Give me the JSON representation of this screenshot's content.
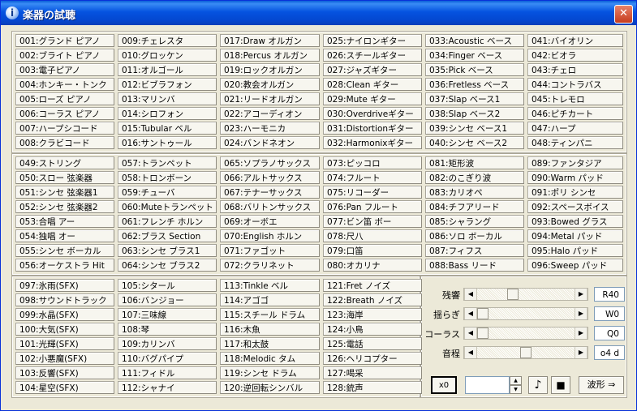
{
  "window": {
    "title": "楽器の試聴",
    "close_label": "✕"
  },
  "instruments": [
    "001:グランド ピアノ",
    "002:ブライト ピアノ",
    "003:電子ピアノ",
    "004:ホンキー・トンク",
    "005:ローズ ピアノ",
    "006:コーラス ピアノ",
    "007:ハープシコード",
    "008:クラビコード",
    "009:チェレスタ",
    "010:グロッケン",
    "011:オルゴール",
    "012:ビブラフォン",
    "013:マリンバ",
    "014:シロフォン",
    "015:Tubular ベル",
    "016:サントゥール",
    "017:Draw オルガン",
    "018:Percus オルガン",
    "019:ロックオルガン",
    "020:教会オルガン",
    "021:リードオルガン",
    "022:アコーディオン",
    "023:ハーモニカ",
    "024:バンドネオン",
    "025:ナイロンギター",
    "026:スチールギター",
    "027:ジャズギター",
    "028:Clean ギター",
    "029:Mute ギター",
    "030:Overdriveギター",
    "031:Distortionギター",
    "032:Harmonixギター",
    "033:Acoustic ベース",
    "034:Finger ベース",
    "035:Pick ベース",
    "036:Fretless ベース",
    "037:Slap ベース1",
    "038:Slap ベース2",
    "039:シンセ ベース1",
    "040:シンセ ベース2",
    "041:バイオリン",
    "042:ビオラ",
    "043:チェロ",
    "044:コントラバス",
    "045:トレモロ",
    "046:ピチカート",
    "047:ハープ",
    "048:ティンパニ",
    "049:ストリング",
    "050:スロー 弦楽器",
    "051:シンセ 弦楽器1",
    "052:シンセ 弦楽器2",
    "053:合唱 アー",
    "054:独唱 オー",
    "055:シンセ ボーカル",
    "056:オーケストラ Hit",
    "057:トランペット",
    "058:トロンボーン",
    "059:チューバ",
    "060:Muteトランペット",
    "061:フレンチ ホルン",
    "062:ブラス Section",
    "063:シンセ ブラス1",
    "064:シンセ ブラス2",
    "065:ソプラノサックス",
    "066:アルトサックス",
    "067:テナーサックス",
    "068:バリトンサックス",
    "069:オーボエ",
    "070:English ホルン",
    "071:ファゴット",
    "072:クラリネット",
    "073:ピッコロ",
    "074:フルート",
    "075:リコーダー",
    "076:Pan フルート",
    "077:ビン笛 ボー",
    "078:尺八",
    "079:口笛",
    "080:オカリナ",
    "081:矩形波",
    "082:のこぎり波",
    "083:カリオペ",
    "084:チフアリード",
    "085:シャラング",
    "086:ソロ ボーカル",
    "087:フィフス",
    "088:Bass リード",
    "089:ファンタジア",
    "090:Warm パッド",
    "091:ポリ シンセ",
    "092:スペースボイス",
    "093:Bowed グラス",
    "094:Metal パッド",
    "095:Halo パッド",
    "096:Sweep パッド",
    "097:氷雨(SFX)",
    "098:サウンドトラック",
    "099:水晶(SFX)",
    "100:大気(SFX)",
    "101:光輝(SFX)",
    "102:小悪魔(SFX)",
    "103:反響(SFX)",
    "104:星空(SFX)",
    "105:シタール",
    "106:バンジョー",
    "107:三味線",
    "108:琴",
    "109:カリンバ",
    "110:バグパイプ",
    "111:フィドル",
    "112:シャナイ",
    "113:Tinkle ベル",
    "114:アゴゴ",
    "115:スチール ドラム",
    "116:木魚",
    "117:和太鼓",
    "118:Melodic タム",
    "119:シンセ ドラム",
    "120:逆回転シンバル",
    "121:Fret ノイズ",
    "122:Breath ノイズ",
    "123:海岸",
    "124:小鳥",
    "125:電話",
    "126:ヘリコプター",
    "127:喝采",
    "128:銃声"
  ],
  "sliders": [
    {
      "label": "残響",
      "value": "R40",
      "level": 0.35
    },
    {
      "label": "揺らぎ",
      "value": "W0",
      "level": 0.0
    },
    {
      "label": "コーラス",
      "value": "Q0",
      "level": 0.0
    },
    {
      "label": "音程",
      "value": "o4 d",
      "level": 0.5
    }
  ],
  "controls": {
    "x0_label": "x0",
    "spin_value": "",
    "play_icon": "♪",
    "stop_icon": "■",
    "wave_label": "波形 ⇒"
  }
}
